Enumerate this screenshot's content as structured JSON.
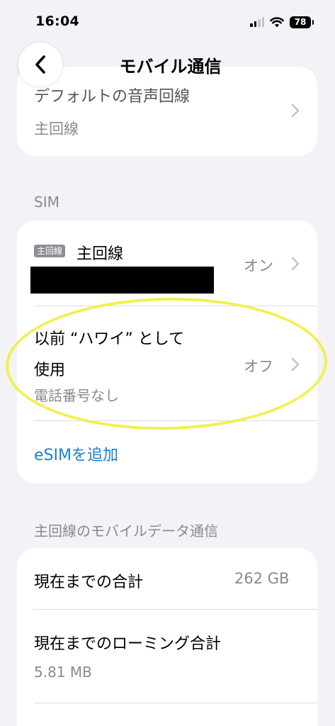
{
  "status_bar": {
    "time": "16:04",
    "battery": "78"
  },
  "nav": {
    "title": "モバイル通信"
  },
  "top_card": {
    "title": "デフォルトの音声回線",
    "subtitle": "主回線"
  },
  "sim_section": {
    "header": "SIM",
    "primary": {
      "badge": "主回線",
      "label": "主回線",
      "value": "オン"
    },
    "previous": {
      "label_line1": "以前 “ハワイ” として",
      "label_line2": "使用",
      "subtitle": "電話番号なし",
      "value": "オフ"
    },
    "add_esim": "eSIMを追加"
  },
  "data_section": {
    "header": "主回線のモバイルデータ通信",
    "rows": [
      {
        "label": "現在までの合計",
        "value": "262 GB"
      },
      {
        "label": "現在までのローミング合計",
        "value": "5.81 MB"
      }
    ]
  },
  "colors": {
    "background": "#f2f2f7",
    "link": "#1c7ed6",
    "highlight": "#f1f050"
  }
}
